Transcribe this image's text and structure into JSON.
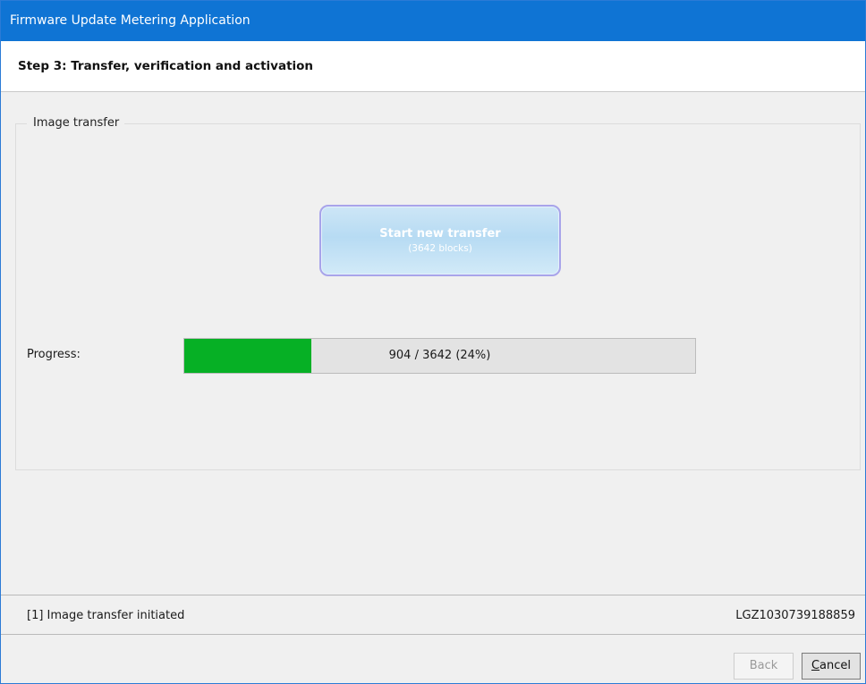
{
  "window": {
    "title": "Firmware Update Metering Application"
  },
  "step": {
    "title": "Step 3: Transfer, verification and activation"
  },
  "image_transfer": {
    "group_label": "Image transfer",
    "start_button": {
      "label": "Start new transfer",
      "sublabel": "(3642 blocks)",
      "enabled": false
    },
    "progress": {
      "label": "Progress:",
      "text": "904 / 3642  (24%)",
      "current": 904,
      "total": 3642,
      "percent": 24
    }
  },
  "status": {
    "message": "[1] Image transfer initiated",
    "device_id": "LGZ1030739188859"
  },
  "footer": {
    "back_label": "Back",
    "back_enabled": false,
    "cancel_mnemonic": "C",
    "cancel_rest": "ancel"
  },
  "colors": {
    "titlebar": "#0f74d4",
    "progress_fill": "#06b025",
    "button_border": "#a8a4ea"
  }
}
